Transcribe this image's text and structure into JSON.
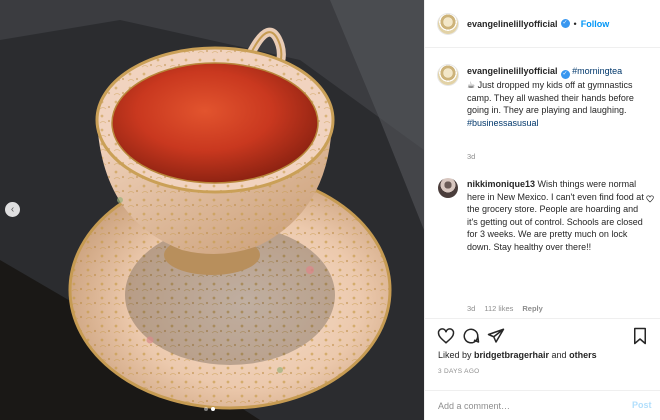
{
  "header": {
    "username": "evangelinelillyofficial",
    "separator": "•",
    "follow_label": "Follow"
  },
  "caption": {
    "username": "evangelinelillyofficial",
    "hashtag_1": "#morningtea",
    "emoji": "☕",
    "text": " Just dropped my kids off at gymnastics camp. They all washed their hands before going in. They are playing and laughing.",
    "hashtag_2": "#businessasusual",
    "time": "3d"
  },
  "comment": {
    "username": "nikkimonique13",
    "text": "Wish things were normal here in New Mexico. I can't even find food at the grocery store. People are hoarding and it's getting out of control. Schools are closed for 3 weeks. We are pretty much on lock down. Stay healthy over there!!",
    "time": "3d",
    "likes": "112 likes",
    "reply_label": "Reply"
  },
  "actions": {
    "like_icon": "heart-icon",
    "comment_icon": "comment-icon",
    "share_icon": "share-icon",
    "save_icon": "bookmark-icon"
  },
  "likes": {
    "prefix": "Liked by ",
    "user": "bridgetbragerhair",
    "middle": " and ",
    "others": "others"
  },
  "date": "3 DAYS AGO",
  "add_comment": {
    "placeholder": "Add a comment…",
    "post_label": "Post"
  },
  "colors": {
    "accent": "#0095f6",
    "verified": "#3897f0",
    "hashtag": "#00376b",
    "muted": "#8e8e8e"
  },
  "carousel": {
    "current": 2,
    "total": 2
  }
}
